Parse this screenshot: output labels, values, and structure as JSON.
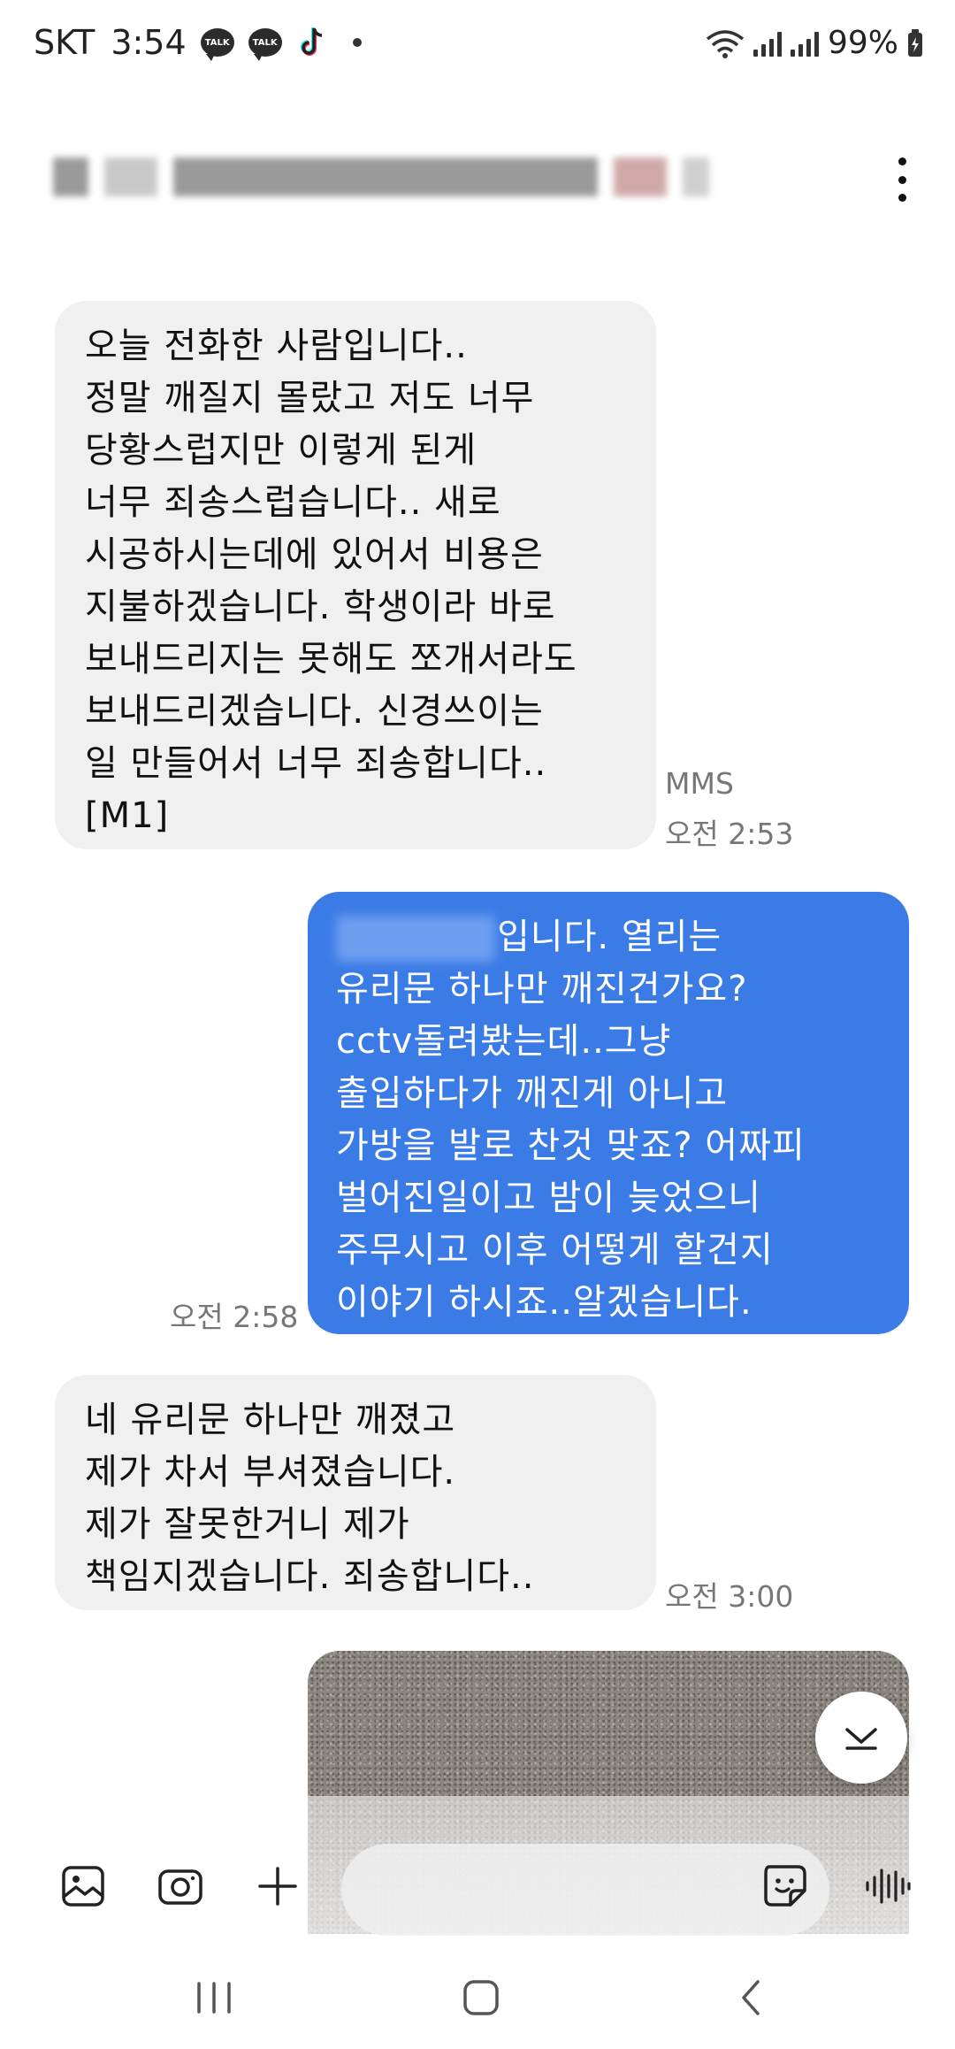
{
  "status_bar": {
    "carrier": "SKT",
    "time": "3:54",
    "talk_badge": "TALK",
    "battery": "99%"
  },
  "messages": [
    {
      "direction": "in",
      "text": "오늘 전화한 사람입니다..\n정말 깨질지 몰랐고 저도 너무\n당황스럽지만 이렇게 된게\n너무 죄송스럽습니다.. 새로\n시공하시는데에 있어서 비용은\n지불하겠습니다. 학생이라 바로\n보내드리지는 못해도 쪼개서라도\n보내드리겠습니다. 신경쓰이는\n일 만들어서 너무 죄송합니다..\n[M1]",
      "type_label": "MMS",
      "time": "오전 2:53"
    },
    {
      "direction": "out",
      "text_first": "입니다. 열리는",
      "text": "유리문 하나만 깨진건가요?\ncctv돌려봤는데..그냥\n출입하다가 깨진게 아니고\n가방을 발로 찬것 맞죠? 어짜피\n벌어진일이고 밤이 늦었으니\n주무시고 이후 어떻게 할건지\n이야기 하시죠..알겠습니다.",
      "time": "오전 2:58"
    },
    {
      "direction": "in",
      "text": "네 유리문 하나만 깨졌고\n제가 차서 부셔졌습니다.\n제가 잘못한거니 제가\n책임지겠습니다. 죄송합니다..",
      "time": "오전 3:00"
    }
  ],
  "icons": {
    "gallery": "image-icon",
    "camera": "camera-icon",
    "add": "plus-icon",
    "sticker": "sticker-icon",
    "voice": "voice-wave-icon",
    "scroll": "chevron-down-icon",
    "menu": "more-vertical-icon"
  },
  "colors": {
    "outgoing_bubble": "#3b7be6",
    "incoming_bubble": "#f0f0f0"
  }
}
